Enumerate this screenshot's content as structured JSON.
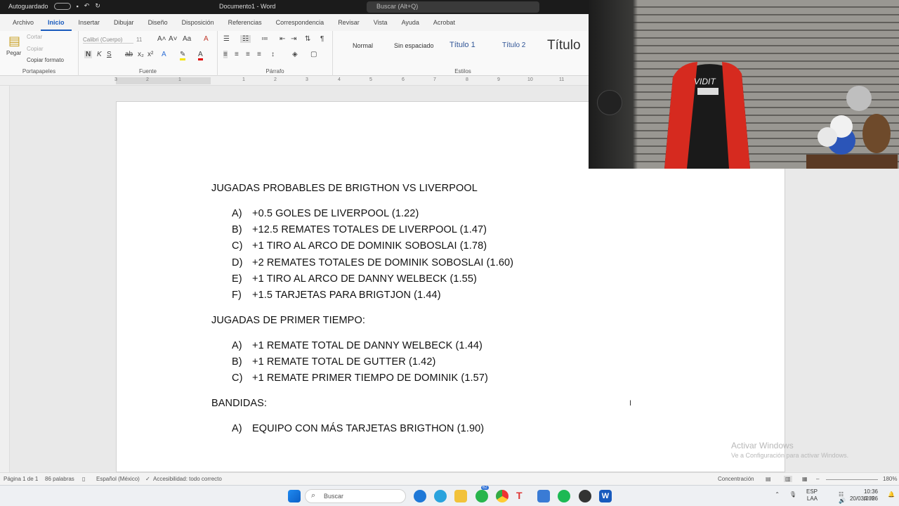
{
  "titlebar": {
    "autosave": "Autoguardado",
    "doc_title": "Documento1 - Word",
    "search_placeholder": "Buscar (Alt+Q)"
  },
  "menu": {
    "tabs": [
      "Archivo",
      "Inicio",
      "Insertar",
      "Dibujar",
      "Diseño",
      "Disposición",
      "Referencias",
      "Correspondencia",
      "Revisar",
      "Vista",
      "Ayuda",
      "Acrobat"
    ]
  },
  "ribbon": {
    "clipboard": {
      "paste": "Pegar",
      "cut": "Cortar",
      "copy": "Copiar",
      "format": "Copiar formato",
      "label": "Portapapeles"
    },
    "font": {
      "name": "Calibri (Cuerpo)",
      "size": "11",
      "label": "Fuente",
      "bold": "N",
      "italic": "K",
      "underline": "S"
    },
    "paragraph": {
      "label": "Párrafo"
    },
    "styles": {
      "label": "Estilos",
      "items": [
        "Normal",
        "Sin espaciado",
        "Título 1",
        "Título 2",
        "Título"
      ]
    }
  },
  "document": {
    "heading1": "JUGADAS PROBABLES DE BRIGTHON VS LIVERPOOL",
    "list1": [
      {
        "letter": "A)",
        "text": "+0.5 GOLES DE LIVERPOOL (1.22)"
      },
      {
        "letter": "B)",
        "text": "+12.5 REMATES TOTALES DE LIVERPOOL (1.47)"
      },
      {
        "letter": "C)",
        "text": "+1 TIRO AL ARCO DE DOMINIK SOBOSLAI (1.78)"
      },
      {
        "letter": "D)",
        "text": "+2 REMATES TOTALES DE DOMINIK SOBOSLAI (1.60)"
      },
      {
        "letter": "E)",
        "text": "+1 TIRO AL ARCO DE DANNY WELBECK (1.55)"
      },
      {
        "letter": "F)",
        "text": "+1.5 TARJETAS PARA BRIGTJON (1.44)"
      }
    ],
    "heading2": "JUGADAS DE PRIMER TIEMPO:",
    "list2": [
      {
        "letter": "A)",
        "text": "+1 REMATE TOTAL DE DANNY WELBECK (1.44)"
      },
      {
        "letter": "B)",
        "text": "+1 REMATE TOTAL DE GUTTER (1.42)"
      },
      {
        "letter": "C)",
        "text": "+1 REMATE PRIMER TIEMPO DE DOMINIK (1.57)"
      }
    ],
    "heading3": "BANDIDAS:",
    "list3": [
      {
        "letter": "A)",
        "text": "EQUIPO CON MÁS TARJETAS BRIGTHON (1.90)"
      }
    ]
  },
  "ruler_numbers": [
    "3",
    "2",
    "1",
    "1",
    "2",
    "3",
    "4",
    "5",
    "6",
    "7",
    "8",
    "9",
    "10",
    "11"
  ],
  "webcam": {
    "chair_brand": "VIDIT"
  },
  "watermark": {
    "line1": "Activar Windows",
    "line2": "Ve a Configuración para activar Windows."
  },
  "status": {
    "page": "Página 1 de 1",
    "words": "86 palabras",
    "language": "Español (México)",
    "accessibility": "Accesibilidad: todo correcto",
    "focus": "Concentración",
    "zoom": "180%"
  },
  "taskbar": {
    "search": "Buscar",
    "lang_top": "ESP",
    "lang_bottom": "LAA",
    "time": "10:36 p. m.",
    "date": "20/03/2026",
    "badge": "62"
  },
  "colors": {
    "word_blue": "#185abd",
    "chair_red": "#d62a1f"
  }
}
